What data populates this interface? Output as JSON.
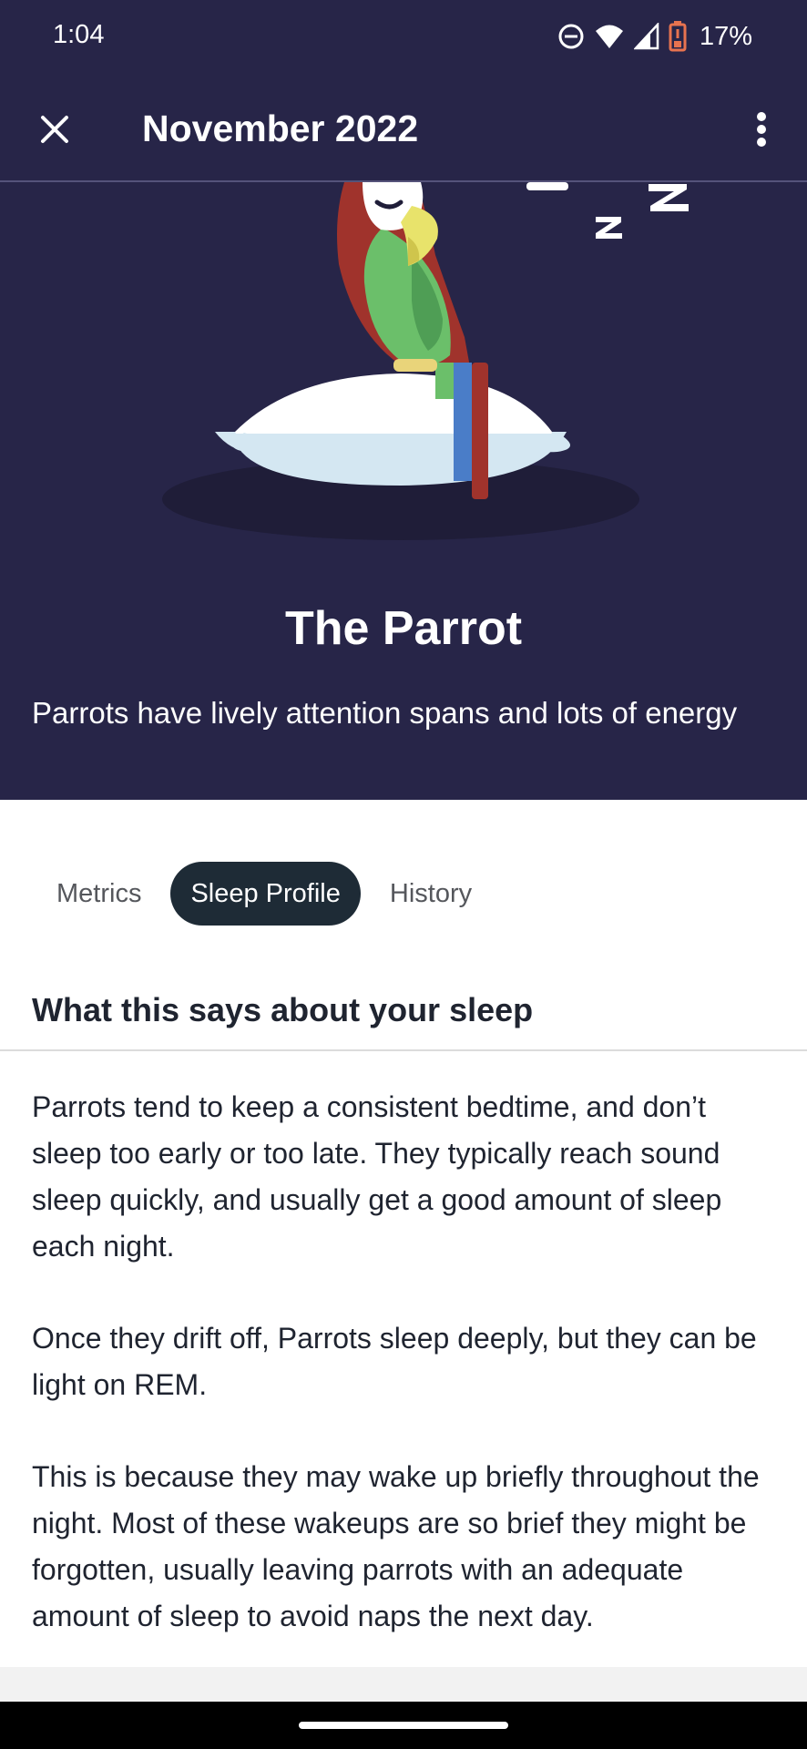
{
  "status_bar": {
    "time": "1:04",
    "battery_percent": "17%",
    "icons": [
      "do-not-disturb-icon",
      "wifi-icon",
      "signal-icon",
      "battery-icon"
    ]
  },
  "appbar": {
    "title": "November 2022",
    "close_icon": "close-icon",
    "menu_icon": "more-vert-icon"
  },
  "hero": {
    "title": "The Parrot",
    "subtitle": "Parrots have lively attention spans and lots of energy"
  },
  "tabs": [
    {
      "label": "Metrics",
      "active": false
    },
    {
      "label": "Sleep Profile",
      "active": true
    },
    {
      "label": "History",
      "active": false
    }
  ],
  "section": {
    "heading": "What this says about your sleep",
    "paragraphs": [
      "Parrots tend to keep a consistent bedtime, and don’t sleep too early or too late. They typically reach sound sleep quickly, and usually get a good amount of sleep each night.",
      "Once they drift off, Parrots sleep deeply, but they can be light on REM.",
      "This is because they may wake up briefly throughout the night. Most of these wakeups are so brief they might be forgotten, usually leaving parrots with an adequate amount of sleep to avoid naps the next day."
    ]
  },
  "colors": {
    "hero_bg": "#272548",
    "active_tab_bg": "#1e2b36",
    "text_dark": "#1f2430"
  }
}
